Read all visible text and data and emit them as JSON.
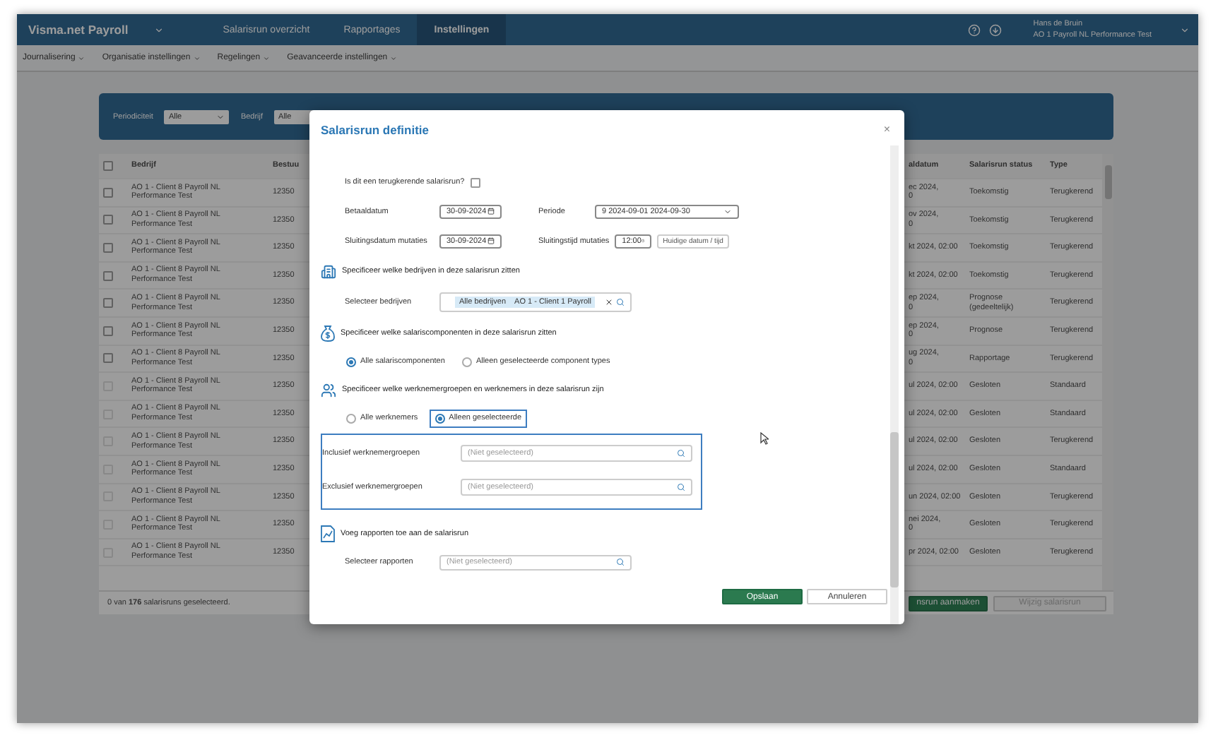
{
  "app": {
    "brand": "Visma.net Payroll",
    "nav": [
      {
        "label": "Salarisrun overzicht",
        "selected": false
      },
      {
        "label": "Rapportages",
        "selected": false
      },
      {
        "label": "Instellingen",
        "selected": true
      }
    ],
    "user": {
      "name": "Hans de Bruin",
      "company": "AO 1 Payroll NL Performance Test"
    }
  },
  "subnav": [
    "Journalisering",
    "Organisatie instellingen",
    "Regelingen",
    "Geavanceerde instellingen"
  ],
  "filters": [
    {
      "label": "Periodiciteit",
      "value": "Alle"
    },
    {
      "label": "Bedrijf",
      "value": "Alle"
    }
  ],
  "table": {
    "select_all_checked": false,
    "columns": [
      "Bedrijf",
      "Bestuu",
      "aldatum",
      "Salarisrun status",
      "Type"
    ],
    "rows": [
      {
        "company": "AO 1 - Client 8 Payroll NL Performance Test",
        "code": "12350",
        "date": [
          "ec 2024,",
          "0"
        ],
        "status": "Toekomstig",
        "type": "Terugkerend",
        "disabled": false
      },
      {
        "company": "AO 1 - Client 8 Payroll NL Performance Test",
        "code": "12350",
        "date": [
          "ov 2024,",
          "0"
        ],
        "status": "Toekomstig",
        "type": "Terugkerend",
        "disabled": false
      },
      {
        "company": "AO 1 - Client 8 Payroll NL Performance Test",
        "code": "12350",
        "date": [
          "kt 2024, 02:00"
        ],
        "status": "Toekomstig",
        "type": "Terugkerend",
        "disabled": false
      },
      {
        "company": "AO 1 - Client 8 Payroll NL Performance Test",
        "code": "12350",
        "date": [
          "kt 2024, 02:00"
        ],
        "status": "Toekomstig",
        "type": "Terugkerend",
        "disabled": false
      },
      {
        "company": "AO 1 - Client 8 Payroll NL Performance Test",
        "code": "12350",
        "date": [
          "ep 2024,",
          "0"
        ],
        "status": "Prognose (gedeeltelijk)",
        "type": "Terugkerend",
        "disabled": false
      },
      {
        "company": "AO 1 - Client 8 Payroll NL Performance Test",
        "code": "12350",
        "date": [
          "ep 2024,",
          "0"
        ],
        "status": "Prognose",
        "type": "Terugkerend",
        "disabled": false
      },
      {
        "company": "AO 1 - Client 8 Payroll NL Performance Test",
        "code": "12350",
        "date": [
          "ug 2024,",
          "0"
        ],
        "status": "Rapportage",
        "type": "Terugkerend",
        "disabled": false
      },
      {
        "company": "AO 1 - Client 8 Payroll NL Performance Test",
        "code": "12350",
        "date": [
          "ul 2024, 02:00"
        ],
        "status": "Gesloten",
        "type": "Standaard",
        "disabled": true
      },
      {
        "company": "AO 1 - Client 8 Payroll NL Performance Test",
        "code": "12350",
        "date": [
          "ul 2024, 02:00"
        ],
        "status": "Gesloten",
        "type": "Standaard",
        "disabled": true
      },
      {
        "company": "AO 1 - Client 8 Payroll NL Performance Test",
        "code": "12350",
        "date": [
          "ul 2024, 02:00"
        ],
        "status": "Gesloten",
        "type": "Terugkerend",
        "disabled": true
      },
      {
        "company": "AO 1 - Client 8 Payroll NL Performance Test",
        "code": "12350",
        "date": [
          "ul 2024, 02:00"
        ],
        "status": "Gesloten",
        "type": "Standaard",
        "disabled": true
      },
      {
        "company": "AO 1 - Client 8 Payroll NL Performance Test",
        "code": "12350",
        "date": [
          "un 2024, 02:00"
        ],
        "status": "Gesloten",
        "type": "Terugkerend",
        "disabled": true
      },
      {
        "company": "AO 1 - Client 8 Payroll NL Performance Test",
        "code": "12350",
        "date": [
          "nei 2024,",
          "0"
        ],
        "status": "Gesloten",
        "type": "Terugkerend",
        "disabled": true
      },
      {
        "company": "AO 1 - Client 8 Payroll NL Performance Test",
        "code": "12350",
        "date": [
          "pr 2024, 02:00"
        ],
        "status": "Gesloten",
        "type": "Terugkerend",
        "disabled": true
      }
    ],
    "footer": "0 van **176** salarisruns geselecteerd."
  },
  "actions": [
    {
      "label": "nsrun aanmaken",
      "disabled": false
    },
    {
      "label": "Wijzig salarisrun",
      "disabled": true
    }
  ],
  "dialog": {
    "title": "Salarisrun definitie",
    "close": "×",
    "recurring": {
      "label": "Is dit een terugkerende salarisrun?",
      "checked": false
    },
    "fields": [
      {
        "label": "Betaaldatum",
        "value": "30-09-2024",
        "kind": "date"
      },
      {
        "label": "Periode",
        "value": "9 2024-09-01 2024-09-30",
        "kind": "select"
      },
      {
        "label": "Sluitingsdatum mutaties",
        "value": "30-09-2024",
        "kind": "date"
      },
      {
        "label": "Sluitingstijd mutaties",
        "value": "12:00",
        "kind": "time",
        "button": "Huidige datum / tijd"
      }
    ],
    "sections": [
      {
        "kind": "companies",
        "heading": "Specificeer welke bedrijven in deze salarisrun zitten",
        "label": "Selecteer bedrijven",
        "tags": [
          "Alle bedrijven",
          "AO 1 - Client 1 Payroll"
        ]
      },
      {
        "kind": "components",
        "heading": "Specificeer welke salariscomponenten in deze salarisrun zitten",
        "options": [
          {
            "label": "Alle salariscomponenten",
            "selected": true,
            "highlighted": false
          },
          {
            "label": "Alleen geselecteerde component types",
            "selected": false,
            "highlighted": false
          }
        ]
      },
      {
        "kind": "employees",
        "heading": "Specificeer welke werknemergroepen en werknemers in deze salarisrun zijn",
        "options": [
          {
            "label": "Alle werknemers",
            "selected": false,
            "highlighted": false
          },
          {
            "label": "Alleen geselecteerde",
            "selected": true,
            "highlighted": true
          }
        ],
        "highlighted": true,
        "pickers": [
          {
            "label": "Inclusief werknemergroepen",
            "placeholder": "(Niet geselecteerd)"
          },
          {
            "label": "Exclusief werknemergroepen",
            "placeholder": "(Niet geselecteerd)"
          }
        ]
      },
      {
        "kind": "reports",
        "heading": "Voeg rapporten toe aan de salarisrun",
        "label": "Selecteer rapporten",
        "placeholder": "(Niet geselecteerd)"
      }
    ],
    "buttons": [
      {
        "label": "Opslaan",
        "kind": "primary"
      },
      {
        "label": "Annuleren",
        "kind": "secondary"
      }
    ]
  }
}
